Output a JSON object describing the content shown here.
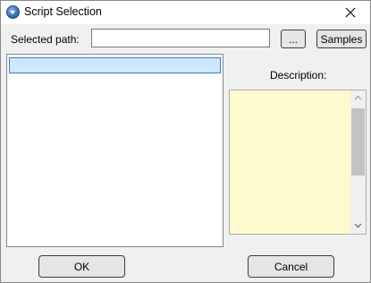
{
  "window": {
    "title": "Script Selection"
  },
  "path": {
    "label": "Selected path:",
    "value": "",
    "placeholder": ""
  },
  "buttons": {
    "browse_label": "...",
    "samples_label": "Samples",
    "ok_label": "OK",
    "cancel_label": "Cancel"
  },
  "script_list": {
    "items": [
      {
        "label": "",
        "selected": true
      }
    ]
  },
  "description": {
    "label": "Description:",
    "text": ""
  },
  "colors": {
    "selection_fill": "#cce8ff",
    "selection_border": "#3a7ebf",
    "description_background": "#fffacd"
  },
  "icons": {
    "app": "script-selection-app-icon",
    "close": "close-icon"
  }
}
